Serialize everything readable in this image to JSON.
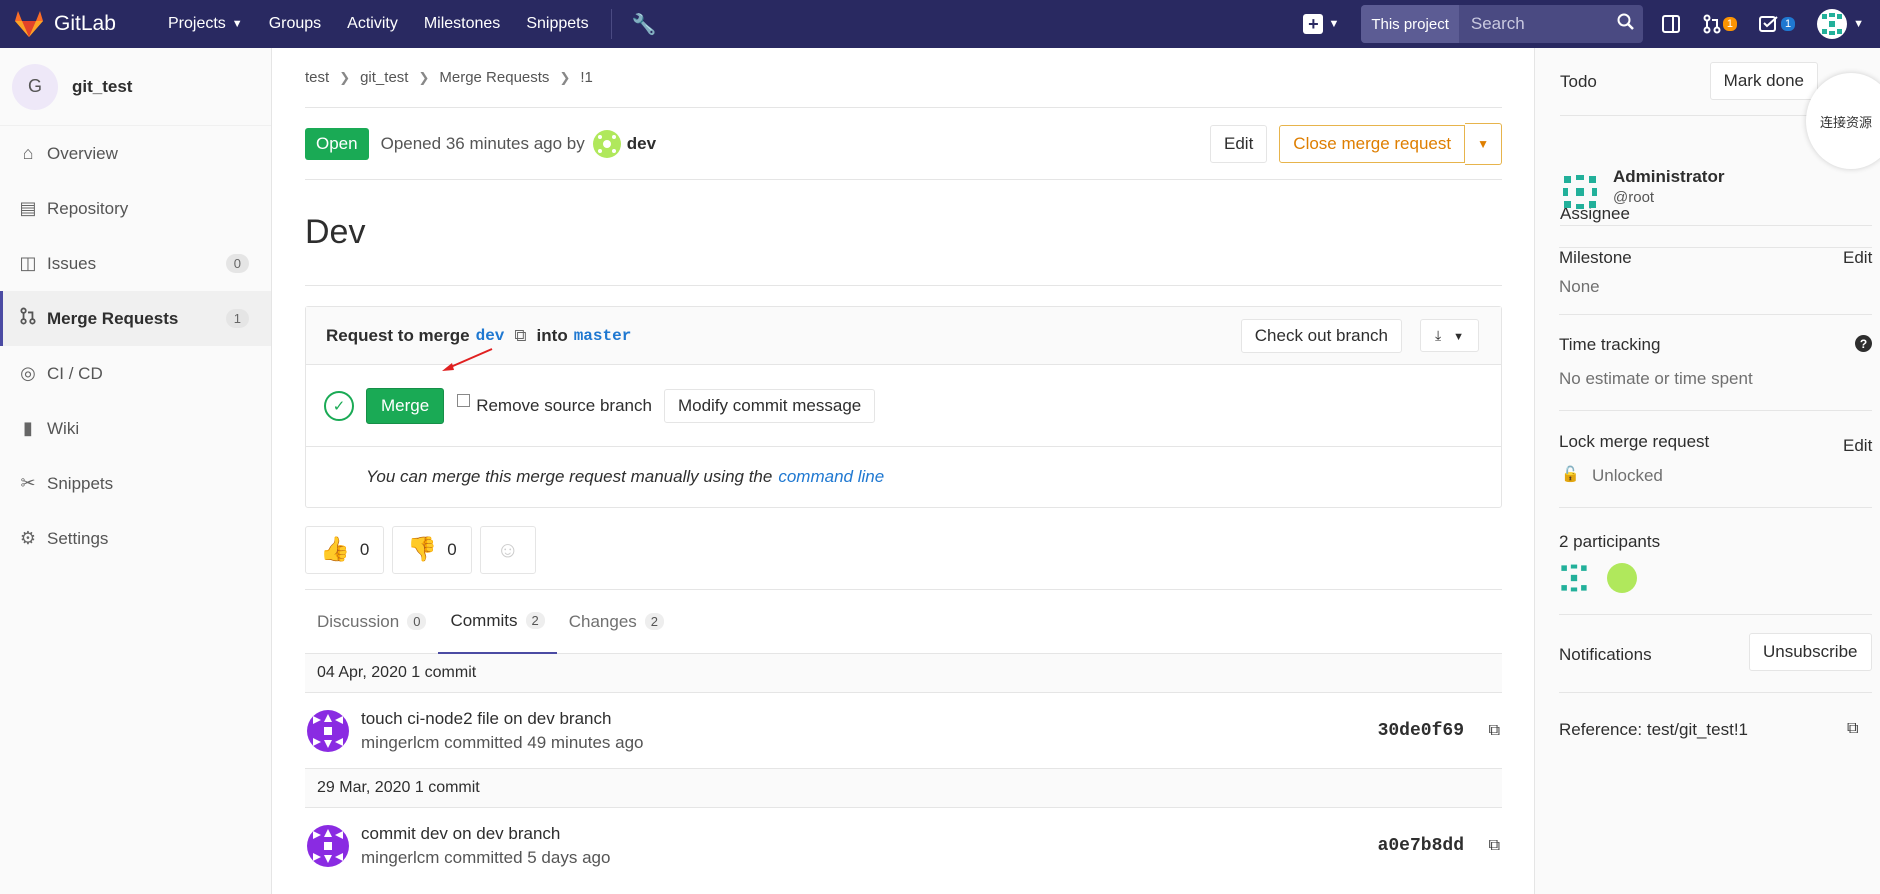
{
  "nav": {
    "brand": "GitLab",
    "links": [
      "Projects",
      "Groups",
      "Activity",
      "Milestones",
      "Snippets"
    ],
    "search_scope": "This project",
    "search_placeholder": "Search",
    "mr_count": "1",
    "todo_count": "1",
    "colors": {
      "bg": "#292961",
      "mr_badge": "#fc9403",
      "todo_badge": "#1f78d1"
    }
  },
  "sidebar": {
    "project_initial": "G",
    "project_name": "git_test",
    "items": [
      {
        "label": "Overview",
        "icon": "home-icon"
      },
      {
        "label": "Repository",
        "icon": "book-icon"
      },
      {
        "label": "Issues",
        "icon": "issues-icon",
        "count": "0"
      },
      {
        "label": "Merge Requests",
        "icon": "merge-request-icon",
        "count": "1"
      },
      {
        "label": "CI / CD",
        "icon": "rocket-icon"
      },
      {
        "label": "Wiki",
        "icon": "wiki-icon"
      },
      {
        "label": "Snippets",
        "icon": "scissors-icon"
      },
      {
        "label": "Settings",
        "icon": "gear-icon"
      }
    ]
  },
  "breadcrumb": [
    "test",
    "git_test",
    "Merge Requests",
    "!1"
  ],
  "mr": {
    "status": "Open",
    "opened": "Opened 36 minutes ago by",
    "author": "dev",
    "edit_label": "Edit",
    "close_label": "Close merge request",
    "title": "Dev",
    "request_prefix": "Request to merge",
    "source_branch": "dev",
    "into": "into",
    "target_branch": "master",
    "checkout_label": "Check out branch",
    "merge_label": "Merge",
    "remove_source_label": "Remove source branch",
    "modify_label": "Modify commit message",
    "manual_text": "You can merge this merge request manually using the",
    "manual_link": "command line",
    "thumbs_up": "0",
    "thumbs_down": "0"
  },
  "tabs": [
    {
      "label": "Discussion",
      "count": "0"
    },
    {
      "label": "Commits",
      "count": "2"
    },
    {
      "label": "Changes",
      "count": "2"
    }
  ],
  "commits": [
    {
      "day": "04 Apr, 2020 1 commit",
      "title": "touch ci-node2 file on dev branch",
      "meta": "mingerlcm committed 49 minutes ago",
      "sha": "30de0f69"
    },
    {
      "day": "29 Mar, 2020 1 commit",
      "title": "commit dev on dev branch",
      "meta": "mingerlcm committed 5 days ago",
      "sha": "a0e7b8dd"
    }
  ],
  "right": {
    "todo_label": "Todo",
    "mark_done": "Mark done",
    "floating": "连接资源",
    "assignee_label": "Assignee",
    "assignee_name": "Administrator",
    "assignee_user": "@root",
    "milestone_label": "Milestone",
    "milestone_edit": "Edit",
    "milestone_val": "None",
    "time_label": "Time tracking",
    "time_val": "No estimate or time spent",
    "lock_label": "Lock merge request",
    "lock_edit": "Edit",
    "lock_val": "Unlocked",
    "participants": "2 participants",
    "notifications": "Notifications",
    "unsubscribe": "Unsubscribe",
    "reference": "Reference: test/git_test!1"
  }
}
